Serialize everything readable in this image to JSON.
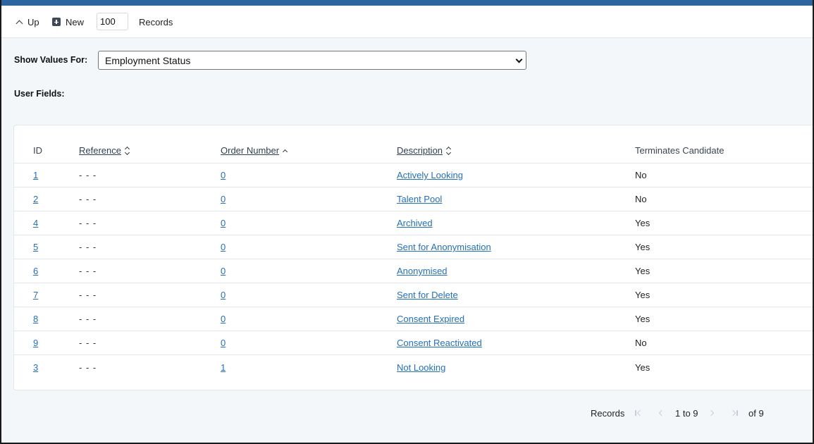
{
  "toolbar": {
    "up_label": "Up",
    "new_label": "New",
    "records_value": "100",
    "records_label": "Records"
  },
  "filter": {
    "label": "Show Values For:",
    "selected": "Employment Status"
  },
  "user_fields_label": "User Fields:",
  "table": {
    "headers": {
      "id": "ID",
      "reference": "Reference",
      "order_number": "Order Number",
      "description": "Description",
      "terminates": "Terminates Candidate"
    },
    "rows": [
      {
        "id": "1",
        "reference": "- - -",
        "order": "0",
        "description": "Actively Looking",
        "terminates": "No"
      },
      {
        "id": "2",
        "reference": "- - -",
        "order": "0",
        "description": "Talent Pool",
        "terminates": "No"
      },
      {
        "id": "4",
        "reference": "- - -",
        "order": "0",
        "description": "Archived",
        "terminates": "Yes"
      },
      {
        "id": "5",
        "reference": "- - -",
        "order": "0",
        "description": "Sent for Anonymisation",
        "terminates": "Yes"
      },
      {
        "id": "6",
        "reference": "- - -",
        "order": "0",
        "description": "Anonymised",
        "terminates": "Yes"
      },
      {
        "id": "7",
        "reference": "- - -",
        "order": "0",
        "description": "Sent for Delete",
        "terminates": "Yes"
      },
      {
        "id": "8",
        "reference": "- - -",
        "order": "0",
        "description": "Consent Expired",
        "terminates": "Yes"
      },
      {
        "id": "9",
        "reference": "- - -",
        "order": "0",
        "description": "Consent Reactivated",
        "terminates": "No"
      },
      {
        "id": "3",
        "reference": "- - -",
        "order": "1",
        "description": "Not Looking",
        "terminates": "Yes"
      }
    ]
  },
  "pager": {
    "records_label": "Records",
    "range": "1 to 9",
    "total": "of 9"
  },
  "colors": {
    "top_bar": "#2c66a0",
    "link": "#1e6fd0",
    "background": "#f4f7fa"
  }
}
